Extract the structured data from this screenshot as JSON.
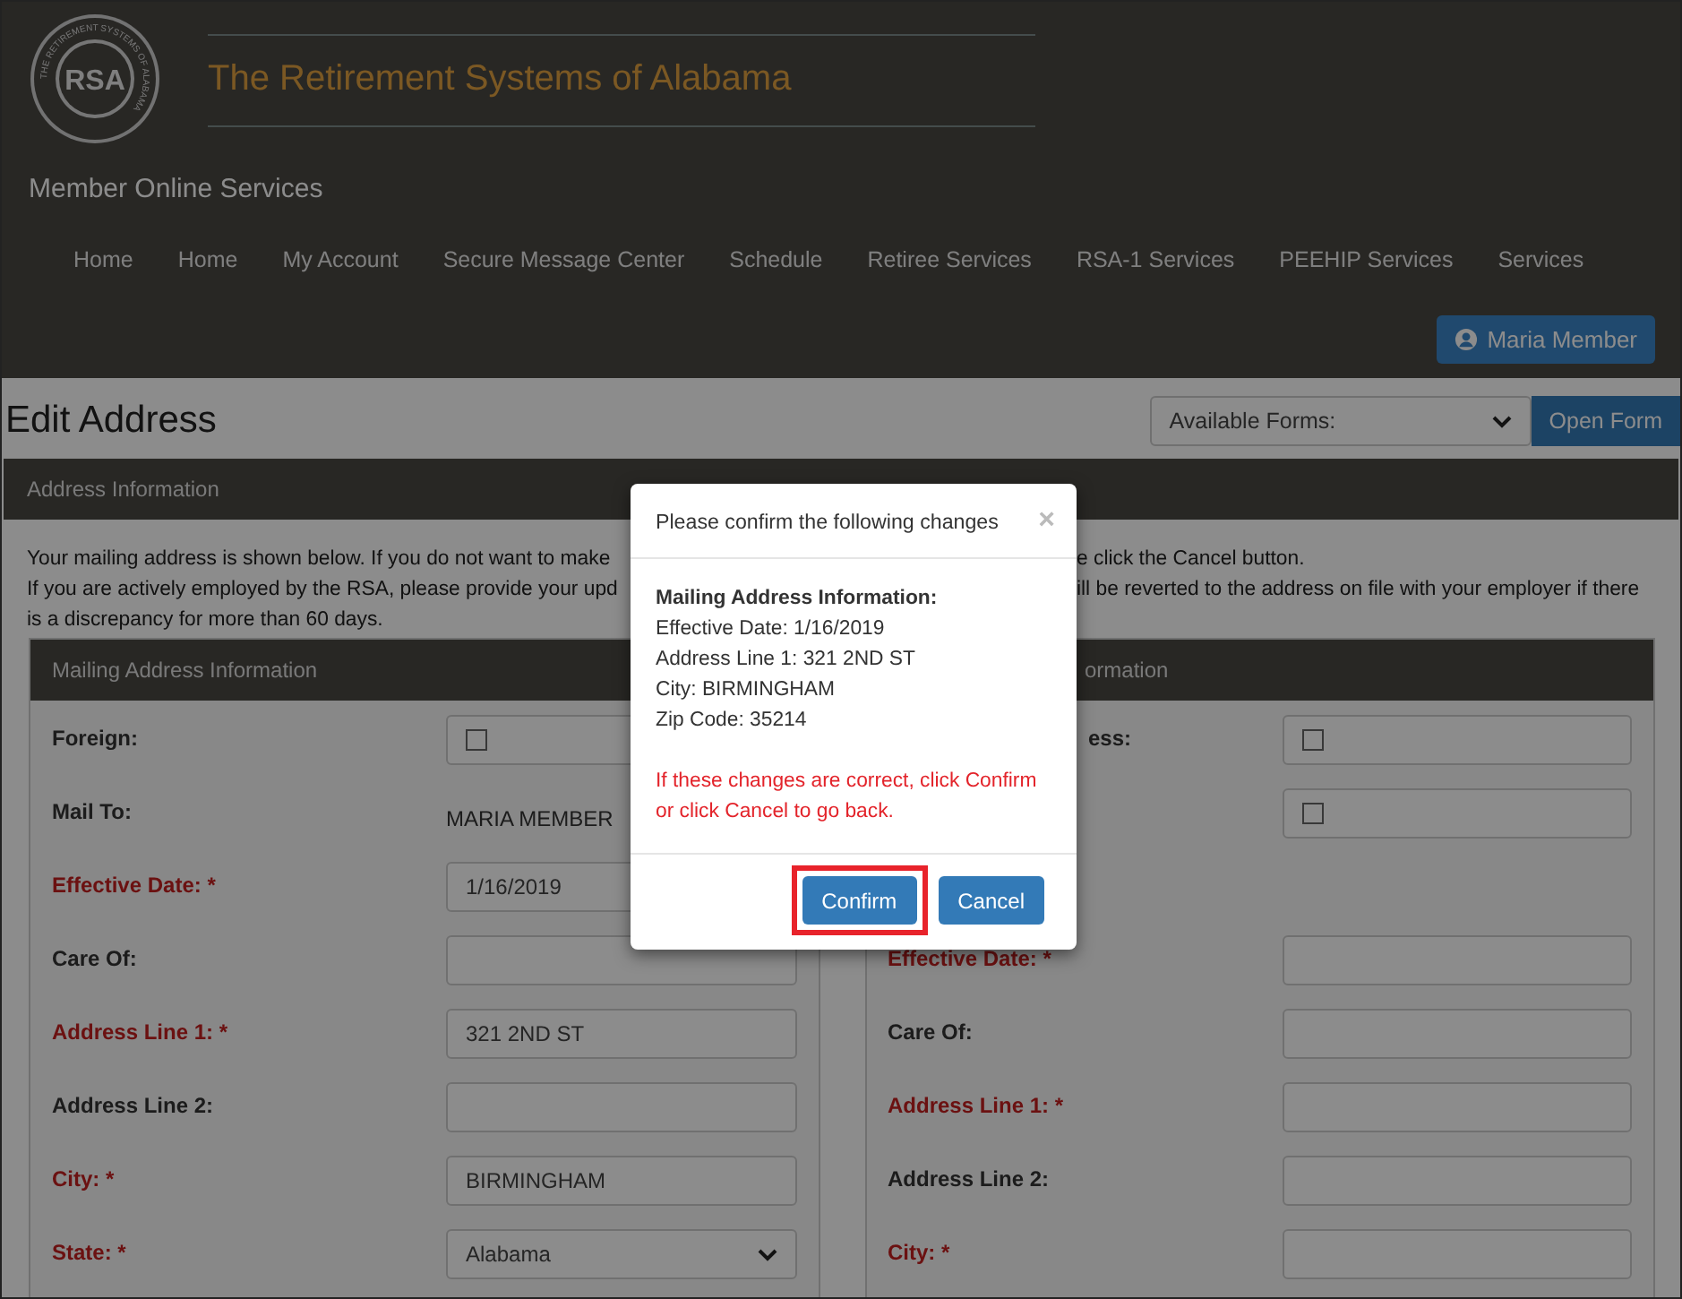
{
  "header": {
    "logo": {
      "monogram": "RSA",
      "ring_text": "THE RETIREMENT SYSTEMS OF ALABAMA"
    },
    "site_title": "The Retirement Systems of Alabama",
    "subtitle": "Member Online Services",
    "nav": [
      "Home",
      "Home",
      "My Account",
      "Secure Message Center",
      "Schedule",
      "Retiree Services",
      "RSA-1 Services",
      "PEEHIP Services",
      "Services"
    ],
    "user_button": "Maria Member"
  },
  "page_title": "Edit Address",
  "forms_select": {
    "value": "Available Forms:"
  },
  "open_form_button": "Open Form",
  "section_title": "Address Information",
  "intro": [
    {
      "left": "Your mailing address is shown below. If you do not want to make",
      "right": "e click the Cancel button."
    },
    {
      "left": "If you are actively employed by the RSA, please provide your upd",
      "right": "ill be reverted to the address on file with your employer if there"
    },
    {
      "left": "is a discrepancy for more than 60 days."
    }
  ],
  "panels": [
    {
      "title": "Mailing Address Information",
      "partial": false,
      "rows": [
        {
          "kind": "checkbox",
          "label": "Foreign:",
          "required": false,
          "checked": false
        },
        {
          "kind": "text",
          "label": "Mail To:",
          "required": false,
          "value": "MARIA MEMBER"
        },
        {
          "kind": "input",
          "label": "Effective Date: *",
          "required": true,
          "value": "1/16/2019"
        },
        {
          "kind": "input",
          "label": "Care Of:",
          "required": false
        },
        {
          "kind": "input",
          "label": "Address Line 1: *",
          "required": true,
          "value": "321 2ND ST"
        },
        {
          "kind": "input",
          "label": "Address Line 2:",
          "required": false
        },
        {
          "kind": "input",
          "label": "City: *",
          "required": true,
          "value": "BIRMINGHAM"
        },
        {
          "kind": "select",
          "label": "State: *",
          "required": true,
          "value": "Alabama"
        }
      ]
    },
    {
      "title": "ormation",
      "partial": true,
      "rows": [
        {
          "kind": "checkbox",
          "label": "ess:",
          "required": false,
          "checked": false,
          "partial": true
        },
        {
          "kind": "checkbox",
          "checked": false
        },
        {
          "kind": "spacer"
        },
        {
          "kind": "input",
          "label": "Effective Date: *",
          "required": true
        },
        {
          "kind": "input",
          "label": "Care Of:",
          "required": false
        },
        {
          "kind": "input",
          "label": "Address Line 1: *",
          "required": true
        },
        {
          "kind": "input",
          "label": "Address Line 2:",
          "required": false
        },
        {
          "kind": "input",
          "label": "City: *",
          "required": true
        }
      ]
    }
  ],
  "modal": {
    "title": "Please confirm the following changes",
    "close": "×",
    "heading": "Mailing Address Information:",
    "lines": [
      "Effective Date: 1/16/2019",
      "Address Line 1: 321 2ND ST",
      "City: BIRMINGHAM",
      "Zip Code: 35214"
    ],
    "warning": "If these changes are correct, click Confirm or click Cancel to go back.",
    "buttons": [
      {
        "label": "Confirm",
        "highlighted": true
      },
      {
        "label": "Cancel",
        "highlighted": false
      }
    ]
  }
}
